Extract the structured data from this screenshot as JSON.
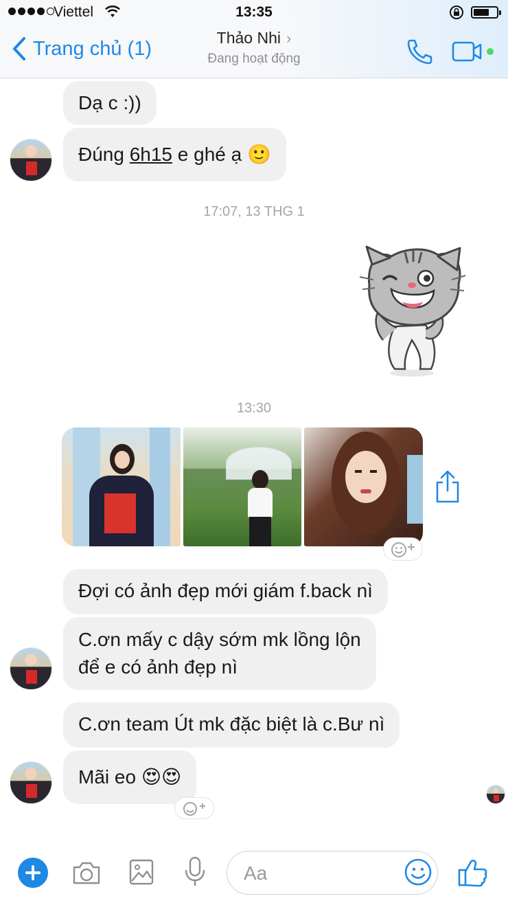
{
  "status_bar": {
    "carrier": "Viettel",
    "time": "13:35"
  },
  "header": {
    "back_label": "Trang chủ (1)",
    "contact_name": "Thảo Nhi",
    "contact_status": "Đang hoạt động"
  },
  "messages": {
    "m1": "Dạ c :))",
    "m2_prefix": "Đúng ",
    "m2_time": "6h15",
    "m2_suffix": " e ghé ạ 🙂",
    "timestamp1": "17:07, 13 THG 1",
    "timestamp2": "13:30",
    "m3": "Đợi có ảnh đẹp mới giám f.back nì",
    "m4_line1": "C.ơn mấy c dậy sớm mk lồng lộn",
    "m4_line2": "để e có ảnh đẹp nì",
    "m5": "C.ơn team Út mk đặc biệt là c.Bư nì",
    "m6": "Mãi eo 😍😍"
  },
  "composer": {
    "placeholder": "Aa"
  },
  "colors": {
    "accent": "#1e88e5",
    "bubble": "#f1f0f0",
    "online": "#4cd964"
  }
}
